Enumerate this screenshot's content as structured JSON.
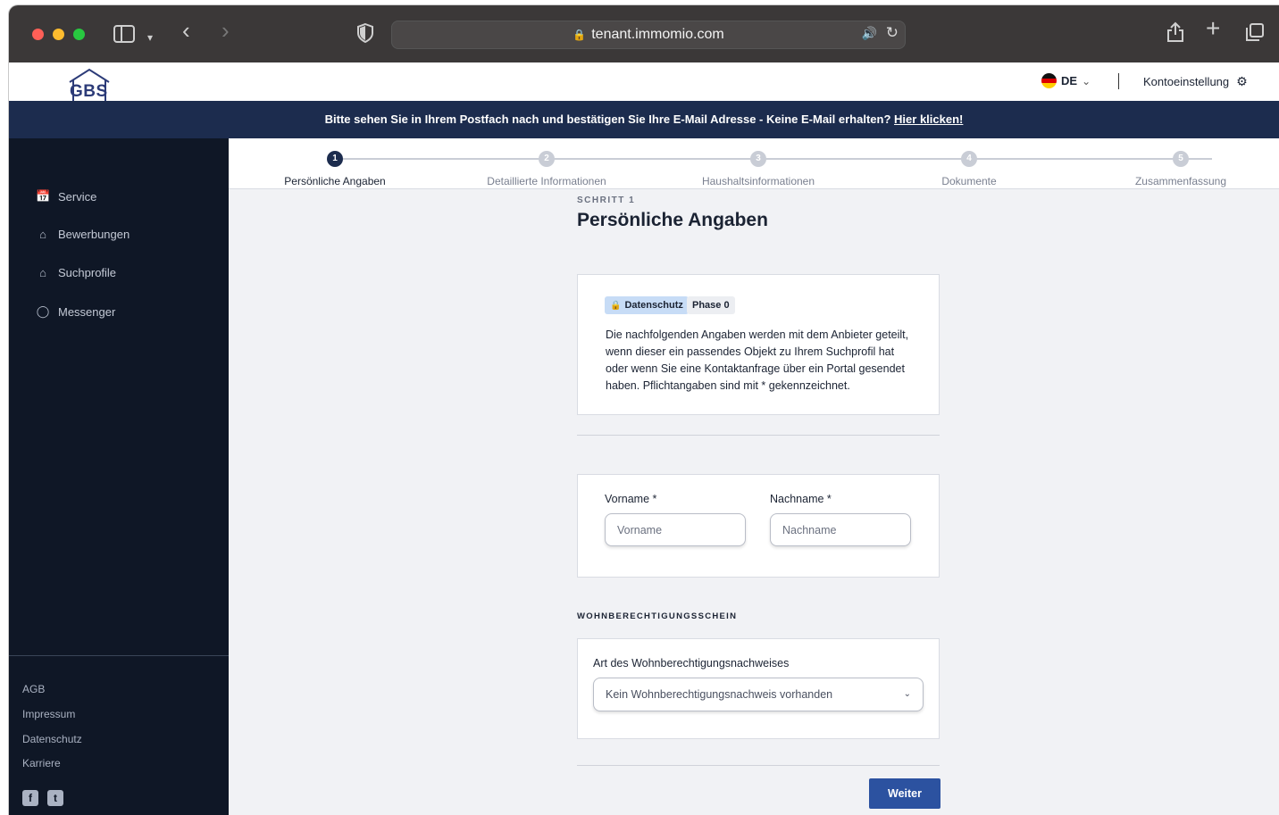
{
  "browser": {
    "url": "tenant.immomio.com"
  },
  "header": {
    "logo_text": "GBS",
    "language": "DE",
    "account_label": "Kontoeinstellung"
  },
  "banner": {
    "text": "Bitte sehen Sie in Ihrem Postfach nach und bestätigen Sie Ihre E-Mail Adresse - Keine E-Mail erhalten?",
    "link_text": "Hier klicken!"
  },
  "sidebar": {
    "items": [
      {
        "label": "Service",
        "icon": "calendar-icon"
      },
      {
        "label": "Bewerbungen",
        "icon": "home-icon"
      },
      {
        "label": "Suchprofile",
        "icon": "house-search-icon"
      },
      {
        "label": "Messenger",
        "icon": "chat-icon"
      }
    ],
    "footer_links": [
      "AGB",
      "Impressum",
      "Datenschutz",
      "Karriere"
    ],
    "social": [
      "facebook-icon",
      "twitter-icon"
    ]
  },
  "stepper": {
    "steps": [
      {
        "number": "1",
        "label": "Persönliche Angaben",
        "active": true
      },
      {
        "number": "2",
        "label": "Detaillierte Informationen",
        "active": false
      },
      {
        "number": "3",
        "label": "Haushaltsinformationen",
        "active": false
      },
      {
        "number": "4",
        "label": "Dokumente",
        "active": false
      },
      {
        "number": "5",
        "label": "Zusammenfassung",
        "active": false
      }
    ]
  },
  "main": {
    "step_caption": "SCHRITT 1",
    "title": "Persönliche Angaben",
    "info_card": {
      "badge_privacy": "Datenschutz",
      "badge_phase": "Phase 0",
      "text": "Die nachfolgenden Angaben werden mit dem Anbieter geteilt, wenn dieser ein passendes Objekt zu Ihrem Suchprofil hat oder wenn Sie eine Kontaktanfrage über ein Portal gesendet haben. Pflichtangaben sind mit * gekennzeichnet."
    },
    "name_card": {
      "first_name_label": "Vorname *",
      "first_name_placeholder": "Vorname",
      "first_name_value": "",
      "last_name_label": "Nachname *",
      "last_name_placeholder": "Nachname",
      "last_name_value": ""
    },
    "wbs_section_title": "WOHNBERECHTIGUNGSSCHEIN",
    "wbs_card": {
      "label": "Art des Wohnberechtigungsnachweises",
      "selected": "Kein Wohnberechtigungsnachweis vorhanden"
    },
    "next_button": "Weiter"
  },
  "colors": {
    "navy": "#1c2c4e",
    "sidebar_bg": "#0f1726",
    "primary_button": "#2c52a0",
    "badge_blue": "#c7dcf6"
  }
}
